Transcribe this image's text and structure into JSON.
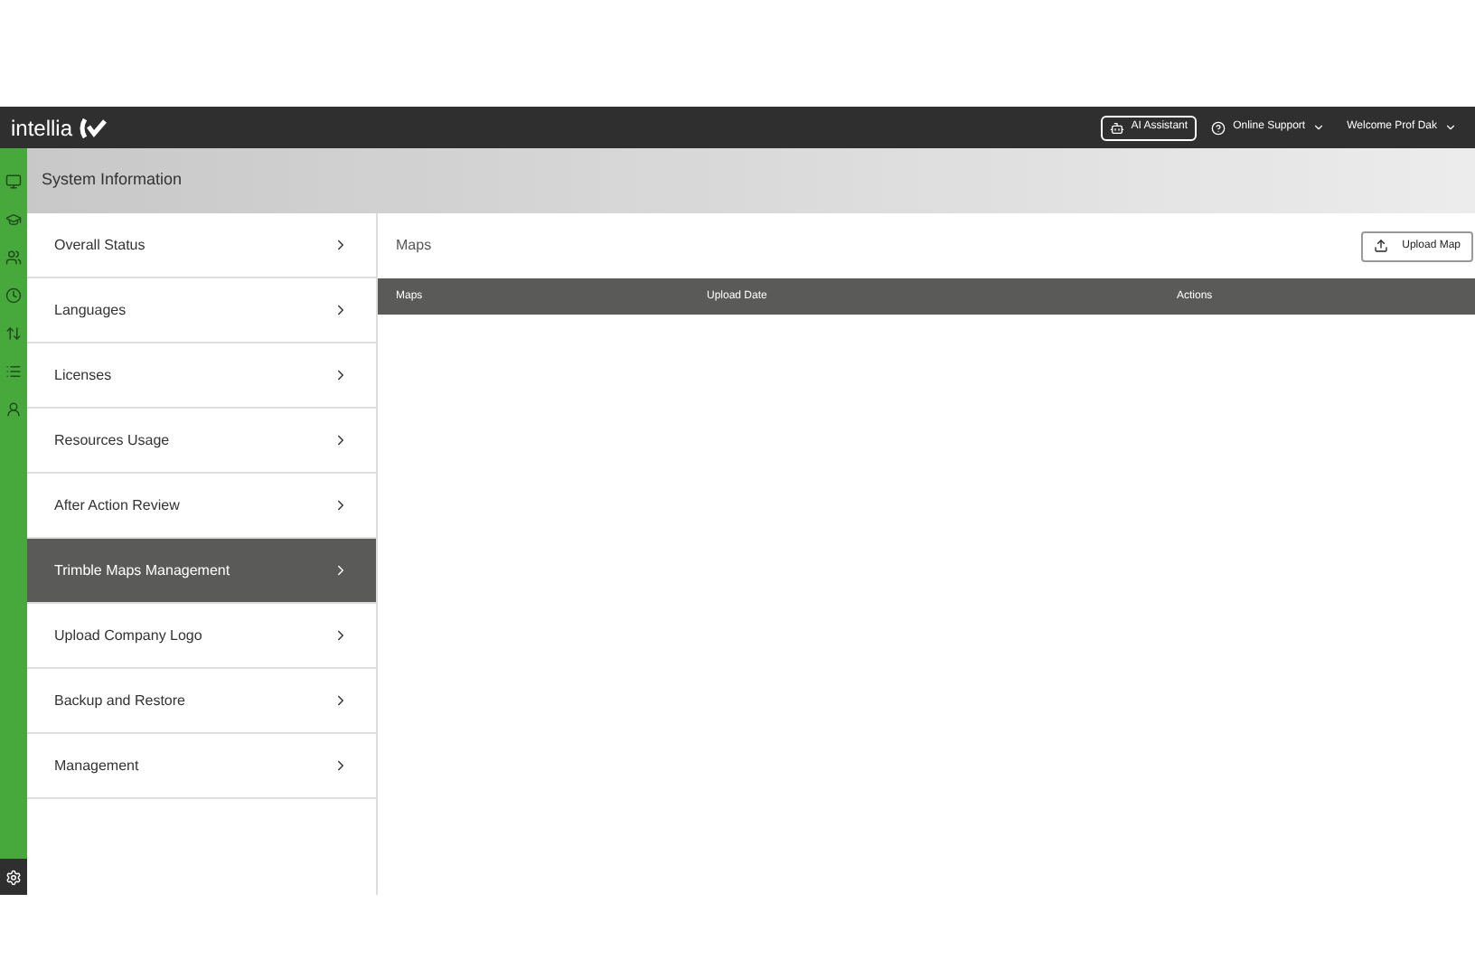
{
  "header": {
    "logo": "intellia",
    "ai_button": "AI Assistant",
    "support": "Online Support",
    "user": "Welcome Prof Dak"
  },
  "page_title": "System Information",
  "menu": [
    {
      "label": "Overall Status",
      "selected": false
    },
    {
      "label": "Languages",
      "selected": false
    },
    {
      "label": "Licenses",
      "selected": false
    },
    {
      "label": "Resources Usage",
      "selected": false
    },
    {
      "label": "After Action Review",
      "selected": false
    },
    {
      "label": "Trimble Maps Management",
      "selected": true
    },
    {
      "label": "Upload Company Logo",
      "selected": false
    },
    {
      "label": "Backup and Restore",
      "selected": false
    },
    {
      "label": "Management",
      "selected": false
    }
  ],
  "panel": {
    "title": "Maps",
    "upload_button": "Upload Map"
  },
  "table": {
    "columns": [
      "Maps",
      "Upload Date",
      "Actions"
    ]
  }
}
